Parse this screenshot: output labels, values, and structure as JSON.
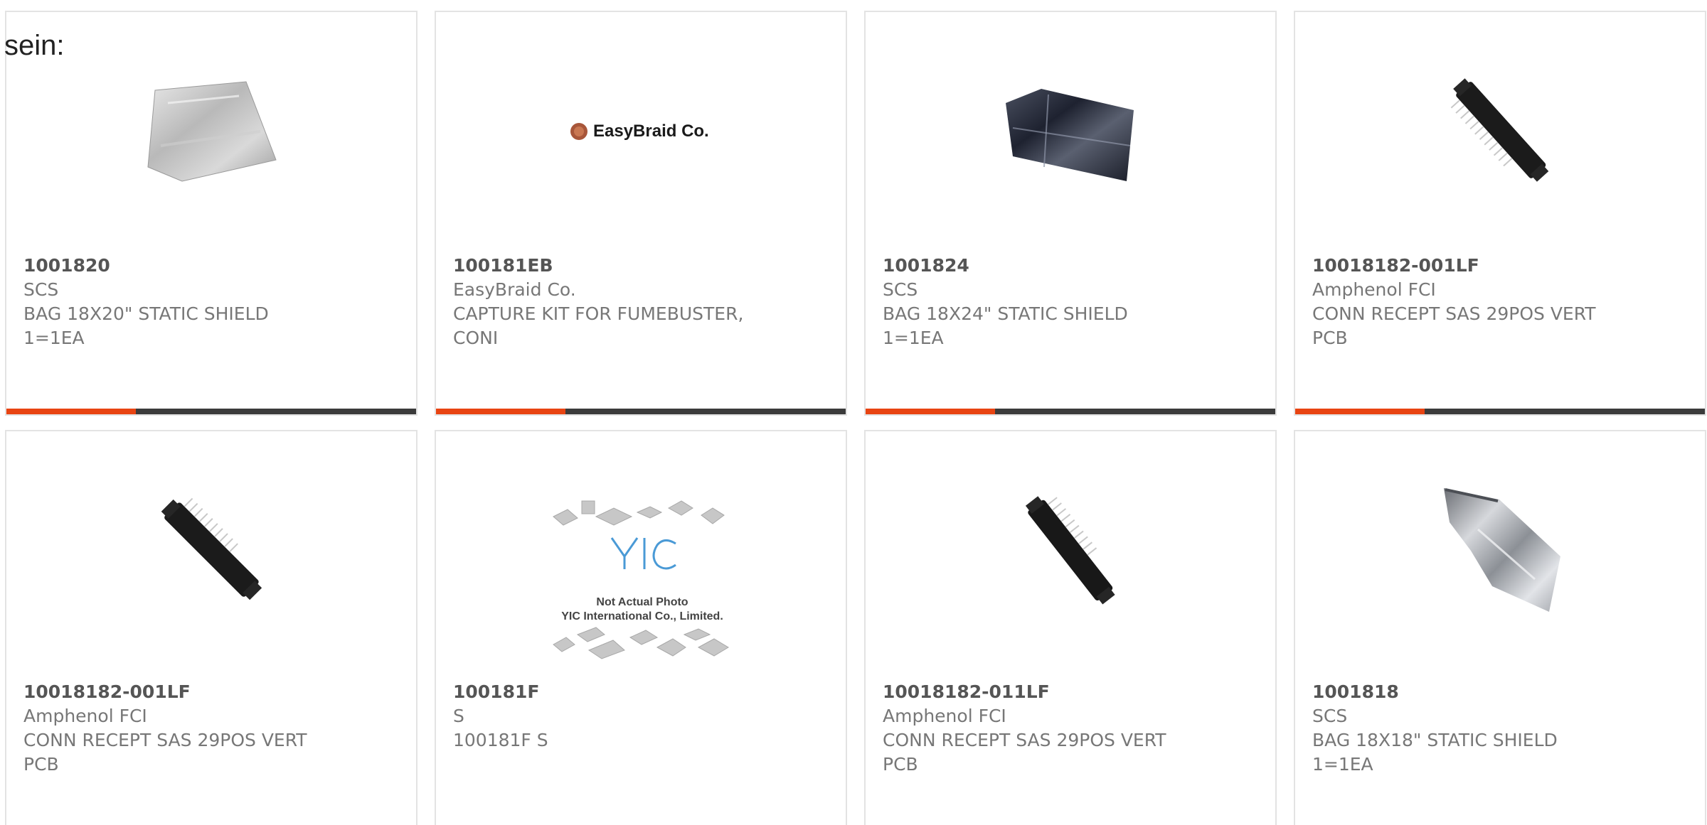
{
  "corner_label": "sein:",
  "colors": {
    "accent": "#e84412",
    "bar": "#3b3b3b",
    "text": "#777777",
    "part": "#555555"
  },
  "products": [
    {
      "part": "1001820",
      "mfr": "SCS",
      "desc1": "BAG 18X20\" STATIC SHIELD",
      "desc2": "1=1EA",
      "image": "silver-static-bag"
    },
    {
      "part": "100181EB",
      "mfr": "EasyBraid Co.",
      "desc1": "CAPTURE KIT FOR FUMEBUSTER,",
      "desc2": "CONI",
      "image": "easybraid-logo",
      "logo_text": "EasyBraid Co."
    },
    {
      "part": "1001824",
      "mfr": "SCS",
      "desc1": "BAG 18X24\" STATIC SHIELD",
      "desc2": "1=1EA",
      "image": "dark-static-bag"
    },
    {
      "part": "10018182-001LF",
      "mfr": "Amphenol FCI",
      "desc1": "CONN RECEPT SAS 29POS VERT",
      "desc2": "PCB",
      "image": "black-connector"
    },
    {
      "part": "10018182-001LF",
      "mfr": "Amphenol FCI",
      "desc1": "CONN RECEPT SAS 29POS VERT",
      "desc2": "PCB",
      "image": "black-connector"
    },
    {
      "part": "100181F",
      "mfr": "S",
      "desc1": "100181F S",
      "desc2": "",
      "image": "yic-placeholder",
      "logo_line1": "Not Actual Photo",
      "logo_line2": "YIC International Co., Limited."
    },
    {
      "part": "10018182-011LF",
      "mfr": "Amphenol FCI",
      "desc1": "CONN RECEPT SAS 29POS VERT",
      "desc2": "PCB",
      "image": "black-connector-alt"
    },
    {
      "part": "1001818",
      "mfr": "SCS",
      "desc1": "BAG 18X18\" STATIC SHIELD",
      "desc2": "1=1EA",
      "image": "silver-static-bag-folded"
    }
  ]
}
